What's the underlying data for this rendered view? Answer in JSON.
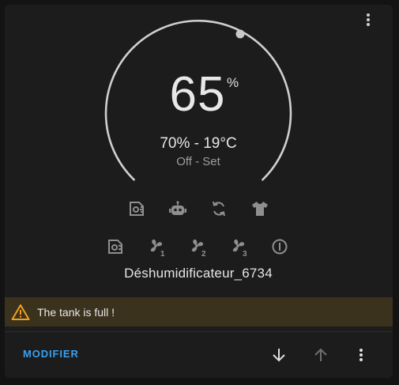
{
  "card": {
    "humidity_value": "65",
    "humidity_unit": "%",
    "sub_status": "70% - 19°C",
    "state": "Off - Set",
    "device_name": "Déshumidificateur_6734",
    "target_level": 0.65
  },
  "mode_icons": [
    "dehumidify-icon",
    "robot-icon",
    "cycle-icon",
    "shirt-icon"
  ],
  "fan_icons": [
    "fan-mode-icon",
    "fan-1-icon",
    "fan-2-icon",
    "fan-3-icon",
    "power-icon"
  ],
  "fan_labels": [
    "1",
    "2",
    "3"
  ],
  "alert": {
    "text": "The tank is full !"
  },
  "footer": {
    "modify_label": "MODIFIER"
  },
  "colors": {
    "background": "#131313",
    "card": "#1c1c1c",
    "accent": "#3aa0ef",
    "alert_bg": "#3b321e",
    "warning": "#f0a020",
    "arc": "#d0d0d0"
  }
}
